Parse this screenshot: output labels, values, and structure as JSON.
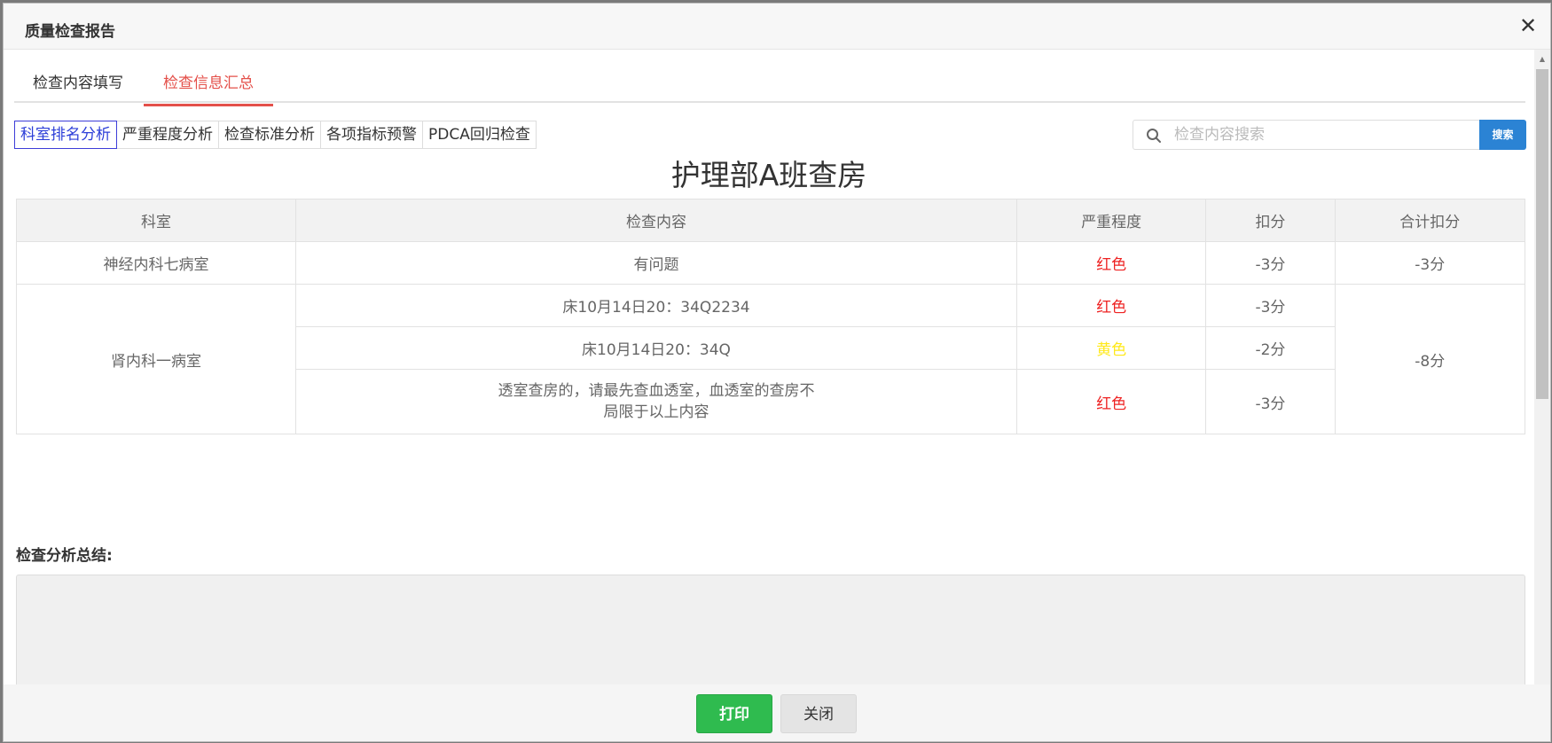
{
  "header": {
    "title": "质量检查报告",
    "close_symbol": "✕"
  },
  "tabs": [
    {
      "label": "检查内容填写"
    },
    {
      "label": "检查信息汇总",
      "active": true
    }
  ],
  "subtabs": [
    {
      "label": "科室排名分析",
      "active": true
    },
    {
      "label": "严重程度分析"
    },
    {
      "label": "检查标准分析"
    },
    {
      "label": "各项指标预警"
    },
    {
      "label": "PDCA回归检查"
    }
  ],
  "search": {
    "placeholder": "检查内容搜索",
    "value": "",
    "button_label": "搜索"
  },
  "report": {
    "title": "护理部A班查房",
    "columns": [
      "科室",
      "检查内容",
      "严重程度",
      "扣分",
      "合计扣分"
    ],
    "groups": [
      {
        "department": "神经内科七病室",
        "total": "-3分",
        "rows": [
          {
            "content": "有问题",
            "severity": "红色",
            "deduction": "-3分"
          }
        ]
      },
      {
        "department": "肾内科一病室",
        "total": "-8分",
        "rows": [
          {
            "content": "床10月14日20：34Q2234",
            "severity": "红色",
            "deduction": "-3分"
          },
          {
            "content": "床10月14日20：34Q",
            "severity": "黄色",
            "deduction": "-2分"
          },
          {
            "content_line1": "透室查房的，请最先查血透室，血透室的查房不",
            "content_line2": "局限于以上内容",
            "severity": "红色",
            "deduction": "-3分"
          }
        ]
      }
    ]
  },
  "summary": {
    "label": "检查分析总结:",
    "value": ""
  },
  "footer": {
    "print_label": "打印",
    "close_label": "关闭"
  },
  "colors": {
    "accent_tab": "#e4504a",
    "active_subtab": "#2c3ed8",
    "search_button": "#2b83d4",
    "severity_red": "#ee2222",
    "severity_yellow": "#ffe91a",
    "print_button": "#2fbb4f"
  }
}
